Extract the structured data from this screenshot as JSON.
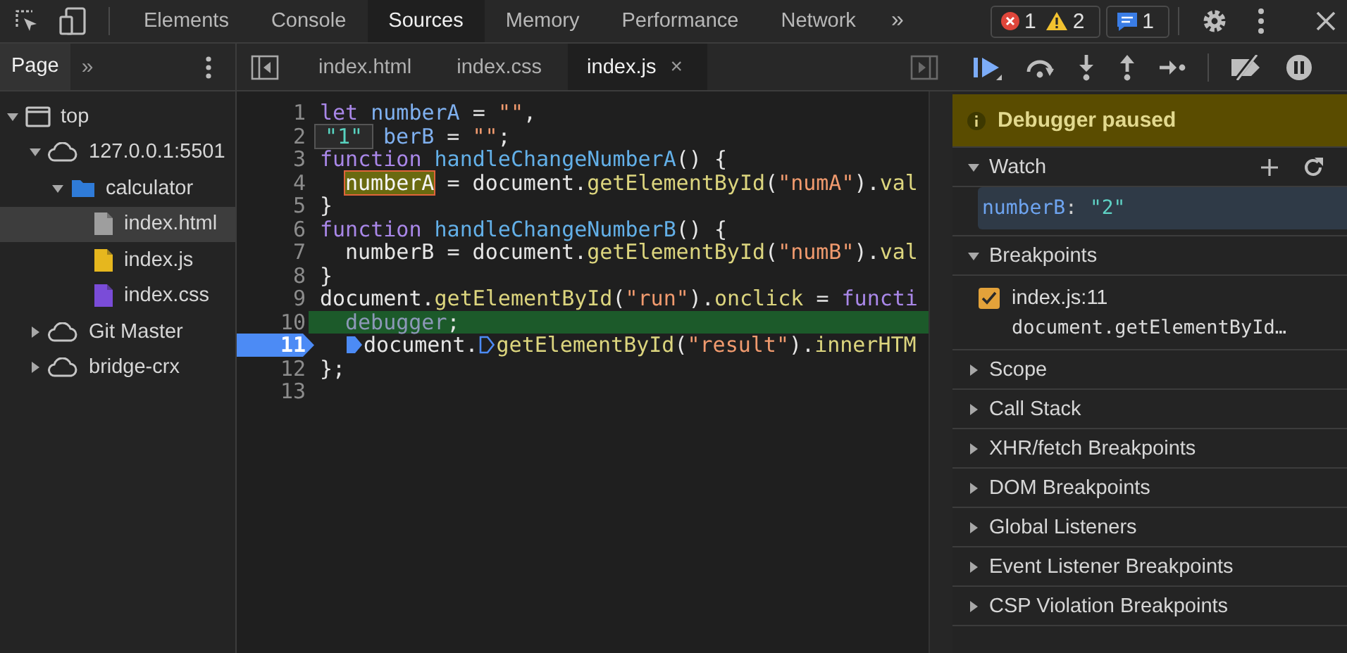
{
  "toolbar": {
    "tabs": [
      {
        "label": "Elements",
        "selected": false
      },
      {
        "label": "Console",
        "selected": false
      },
      {
        "label": "Sources",
        "selected": true
      },
      {
        "label": "Memory",
        "selected": false
      },
      {
        "label": "Performance",
        "selected": false
      },
      {
        "label": "Network",
        "selected": false
      }
    ],
    "overflow": "»",
    "badges": [
      {
        "kind": "error",
        "count": "1"
      },
      {
        "kind": "warning",
        "count": "2"
      },
      {
        "kind": "message",
        "count": "1"
      }
    ]
  },
  "navigator": {
    "tabs": [
      {
        "label": "Page",
        "selected": true
      }
    ],
    "overflow": "»",
    "tree": [
      {
        "label": "top",
        "kind": "frame",
        "expanded": true,
        "selected": false,
        "children": [
          {
            "label": "127.0.0.1:5501",
            "kind": "origin",
            "expanded": true,
            "selected": false,
            "children": [
              {
                "label": "calculator",
                "kind": "folder",
                "expanded": true,
                "selected": false,
                "children": [
                  {
                    "label": "index.html",
                    "kind": "file",
                    "color": "#9e9e9e",
                    "selected": true
                  },
                  {
                    "label": "index.js",
                    "kind": "file",
                    "color": "#e6b71e",
                    "selected": false
                  },
                  {
                    "label": "index.css",
                    "kind": "file",
                    "color": "#7a4cd8",
                    "selected": false
                  }
                ]
              }
            ]
          },
          {
            "label": "Git Master",
            "kind": "origin",
            "expanded": false,
            "selected": false
          },
          {
            "label": "bridge-crx",
            "kind": "origin",
            "expanded": false,
            "selected": false
          }
        ]
      }
    ]
  },
  "editor": {
    "tabs": [
      {
        "label": "index.html",
        "selected": false
      },
      {
        "label": "index.css",
        "selected": false
      },
      {
        "label": "index.js",
        "selected": true,
        "close": "×"
      }
    ],
    "lines": [
      {
        "number": "1",
        "paused": false,
        "breakpoint": false,
        "tokens": [
          {
            "kind": "kw",
            "text": "let "
          },
          {
            "kind": "def",
            "text": "numberA"
          },
          {
            "kind": "plain",
            "text": " = "
          },
          {
            "kind": "str",
            "text": "\"\""
          },
          {
            "kind": "plain",
            "text": ","
          }
        ]
      },
      {
        "number": "2",
        "paused": false,
        "breakpoint": false,
        "tooltip": "\"1\"",
        "tokens": [
          {
            "kind": "def",
            "text": "berB"
          },
          {
            "kind": "plain",
            "text": " = "
          },
          {
            "kind": "str",
            "text": "\"\""
          },
          {
            "kind": "plain",
            "text": ";"
          }
        ]
      },
      {
        "number": "3",
        "paused": false,
        "breakpoint": false,
        "tokens": [
          {
            "kind": "kw",
            "text": "function "
          },
          {
            "kind": "fn",
            "text": "handleChangeNumberA"
          },
          {
            "kind": "plain",
            "text": "() {"
          }
        ]
      },
      {
        "number": "4",
        "paused": false,
        "breakpoint": false,
        "indented": true,
        "tokens": [
          {
            "kind": "hl",
            "text": "numberA"
          },
          {
            "kind": "plain",
            "text": " = document."
          },
          {
            "kind": "method",
            "text": "getElementById"
          },
          {
            "kind": "plain",
            "text": "("
          },
          {
            "kind": "str",
            "text": "\"numA\""
          },
          {
            "kind": "plain",
            "text": ")."
          },
          {
            "kind": "method",
            "text": "val"
          }
        ]
      },
      {
        "number": "5",
        "paused": false,
        "breakpoint": false,
        "tokens": [
          {
            "kind": "plain",
            "text": "}"
          }
        ]
      },
      {
        "number": "6",
        "paused": false,
        "breakpoint": false,
        "tokens": [
          {
            "kind": "kw",
            "text": "function "
          },
          {
            "kind": "fn",
            "text": "handleChangeNumberB"
          },
          {
            "kind": "plain",
            "text": "() {"
          }
        ]
      },
      {
        "number": "7",
        "paused": false,
        "breakpoint": false,
        "indented": true,
        "tokens": [
          {
            "kind": "plain",
            "text": "numberB = document."
          },
          {
            "kind": "method",
            "text": "getElementById"
          },
          {
            "kind": "plain",
            "text": "("
          },
          {
            "kind": "str",
            "text": "\"numB\""
          },
          {
            "kind": "plain",
            "text": ")."
          },
          {
            "kind": "method",
            "text": "val"
          }
        ]
      },
      {
        "number": "8",
        "paused": false,
        "breakpoint": false,
        "tokens": [
          {
            "kind": "plain",
            "text": "}"
          }
        ]
      },
      {
        "number": "9",
        "paused": false,
        "breakpoint": false,
        "tokens": [
          {
            "kind": "plain",
            "text": "document."
          },
          {
            "kind": "method",
            "text": "getElementById"
          },
          {
            "kind": "plain",
            "text": "("
          },
          {
            "kind": "str",
            "text": "\"run\""
          },
          {
            "kind": "plain",
            "text": ")."
          },
          {
            "kind": "method",
            "text": "onclick"
          },
          {
            "kind": "plain",
            "text": " = "
          },
          {
            "kind": "kw",
            "text": "functi"
          }
        ]
      },
      {
        "number": "10",
        "paused": true,
        "breakpoint": false,
        "indented": true,
        "tokens": [
          {
            "kind": "kwdim",
            "text": "debugger"
          },
          {
            "kind": "plain",
            "text": ";"
          }
        ]
      },
      {
        "number": "11",
        "paused": false,
        "breakpoint": true,
        "indented": true,
        "tokens": [
          {
            "kind": "bp-active"
          },
          {
            "kind": "plain",
            "text": "document."
          },
          {
            "kind": "bp-inactive"
          },
          {
            "kind": "method",
            "text": "getElementById"
          },
          {
            "kind": "plain",
            "text": "("
          },
          {
            "kind": "str",
            "text": "\"result\""
          },
          {
            "kind": "plain",
            "text": ")."
          },
          {
            "kind": "method",
            "text": "innerHTM"
          }
        ]
      },
      {
        "number": "12",
        "paused": false,
        "breakpoint": false,
        "tokens": [
          {
            "kind": "plain",
            "text": "};"
          }
        ]
      },
      {
        "number": "13",
        "paused": false,
        "breakpoint": false
      }
    ]
  },
  "debugger": {
    "banner": "Debugger paused",
    "sections": [
      {
        "title": "Watch",
        "kind": "watch",
        "expanded": true,
        "watch": [
          {
            "name": "numberB",
            "separator": ":",
            "value": "\"2\""
          }
        ]
      },
      {
        "title": "Breakpoints",
        "kind": "breakpoints",
        "expanded": true,
        "breakpoints": [
          {
            "location": "index.js:11",
            "code": "document.getElementById…",
            "checked": true
          }
        ]
      },
      {
        "title": "Scope",
        "kind": "plain",
        "expanded": false
      },
      {
        "title": "Call Stack",
        "kind": "plain",
        "expanded": false
      },
      {
        "title": "XHR/fetch Breakpoints",
        "kind": "plain",
        "expanded": false
      },
      {
        "title": "DOM Breakpoints",
        "kind": "plain",
        "expanded": false
      },
      {
        "title": "Global Listeners",
        "kind": "plain",
        "expanded": false
      },
      {
        "title": "Event Listener Breakpoints",
        "kind": "plain",
        "expanded": false
      },
      {
        "title": "CSP Violation Breakpoints",
        "kind": "plain",
        "expanded": false
      }
    ]
  }
}
